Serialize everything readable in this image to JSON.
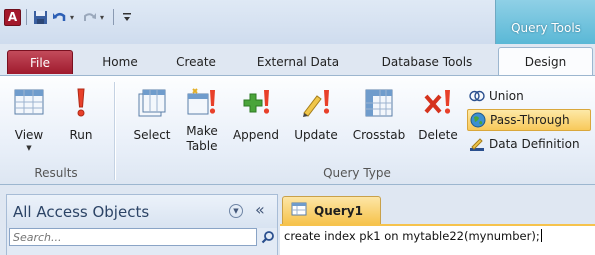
{
  "app": {
    "logo_letter": "A"
  },
  "context_tab": {
    "title": "Query Tools"
  },
  "tabs": [
    {
      "label": "File"
    },
    {
      "label": "Home"
    },
    {
      "label": "Create"
    },
    {
      "label": "External Data"
    },
    {
      "label": "Database Tools"
    },
    {
      "label": "Design"
    }
  ],
  "ribbon": {
    "results": {
      "group_label": "Results",
      "view_label": "View",
      "run_label": "Run"
    },
    "query_type": {
      "group_label": "Query Type",
      "select_label": "Select",
      "make_table_label_1": "Make",
      "make_table_label_2": "Table",
      "append_label": "Append",
      "update_label": "Update",
      "crosstab_label": "Crosstab",
      "delete_label": "Delete",
      "union_label": "Union",
      "pass_through_label": "Pass-Through",
      "data_definition_label": "Data Definition"
    }
  },
  "nav_pane": {
    "title": "All Access Objects",
    "search_placeholder": "Search..."
  },
  "document": {
    "tab_label": "Query1",
    "sql_text": "create index pk1 on mytable22(mynumber);"
  },
  "colors": {
    "file_tab": "#a3182b",
    "context_tab": "#5ab8d6",
    "document_tab": "#f6c34d",
    "pass_through_highlight": "#f8c95a"
  }
}
